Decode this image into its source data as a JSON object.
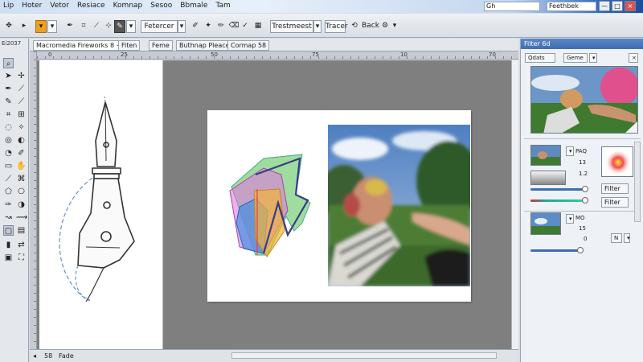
{
  "titlebar": {
    "menu": [
      "Lip",
      "Hoter",
      "Vetor",
      "Resiace",
      "Komnap",
      "Sesoo",
      "Bbmale",
      "Tam"
    ],
    "search_value": "Gh",
    "field_value": "Feethbek",
    "min_label": "—",
    "max_label": "□",
    "close_label": "×"
  },
  "toolbar": {
    "fill_dropdown": "Fetercer",
    "style_dropdown": "Trestmeest",
    "effect_label": "Tracer",
    "back_label": "Back"
  },
  "tools": {
    "header": "Ei2037",
    "icons": [
      "pointer-icon",
      "subselect-icon",
      "pen-icon",
      "line-icon",
      "pencil-icon",
      "brush-icon",
      "crop-icon",
      "scale-icon",
      "lasso-icon",
      "magic-wand-icon",
      "eraser-icon",
      "blur-icon",
      "text-icon",
      "shape-icon",
      "hand-icon",
      "zoom-icon"
    ]
  },
  "doctabs": {
    "tabs": [
      "Macromedia Fireworks 8 ÷",
      "Fiten",
      "Feme",
      "Buthnap Pleace",
      "Cormap 58"
    ]
  },
  "ruler": {
    "labels": [
      "0",
      "25",
      "50",
      "75",
      "10",
      "70"
    ]
  },
  "statusbar": {
    "left": "◂",
    "page": "58",
    "mode": "Fade"
  },
  "rpanel": {
    "title": "Filter 6d",
    "tab_left": "Qdats",
    "tab_mid": "Geme",
    "layer1_label": "PAQ",
    "value_13": "13",
    "value_12": "1.2",
    "button_filter": "Filter",
    "button_filter2": "Filter",
    "layer2_label": "MO",
    "value_15": "15",
    "value_0": "0",
    "value_n": "N"
  },
  "colors": {
    "accent": "#3f6db3",
    "toolbar_orange": "#f0a020",
    "canvas_gray": "#7f7f7f"
  }
}
